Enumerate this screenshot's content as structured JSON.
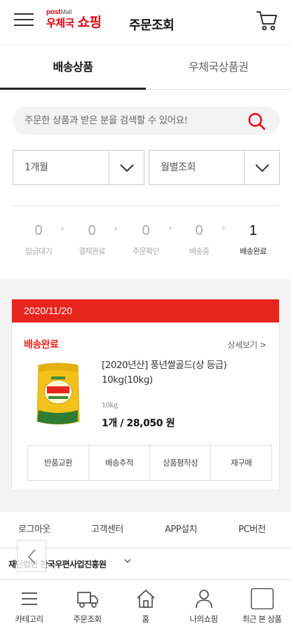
{
  "header": {
    "logo_top": "post",
    "logo_top_small": "Mall",
    "logo_prefix": "우체국",
    "logo_main": "쇼핑",
    "title": "주문조회"
  },
  "tabs": [
    {
      "label": "배송상품",
      "active": true
    },
    {
      "label": "우체국상품권",
      "active": false
    }
  ],
  "search": {
    "placeholder": "주문한 상품과 받은 분을 검색할 수 있어요!"
  },
  "filters": {
    "period": "1개월",
    "mode": "월별조회"
  },
  "steps": [
    {
      "count": "0",
      "label": "입금대기"
    },
    {
      "count": "0",
      "label": "결제완료"
    },
    {
      "count": "0",
      "label": "주문확인"
    },
    {
      "count": "0",
      "label": "배송중"
    },
    {
      "count": "1",
      "label": "배송완료"
    }
  ],
  "order": {
    "date": "2020/11/20",
    "status": "배송완료",
    "detail_link": "상세보기 >",
    "product_name": "[2020년산] 풍년쌀골드(상 등급) 10kg(10kg)",
    "option": "10kg",
    "price": "1개 / 28,050 원",
    "actions": [
      "반품교환",
      "배송추적",
      "상품평작성",
      "재구매"
    ]
  },
  "footer_links": [
    "로그아웃",
    "고객센터",
    "APP설치",
    "PC버전"
  ],
  "company": "재단법인 한국우편사업진흥원",
  "bottom_nav": [
    {
      "label": "카테고리",
      "icon": "menu-icon"
    },
    {
      "label": "주문조회",
      "icon": "truck-icon"
    },
    {
      "label": "홈",
      "icon": "home-icon"
    },
    {
      "label": "나의쇼핑",
      "icon": "user-icon"
    },
    {
      "label": "최근 본 상품",
      "icon": "recent-icon"
    }
  ],
  "colors": {
    "brand_red": "#e8251d",
    "search_red": "#e60012"
  }
}
